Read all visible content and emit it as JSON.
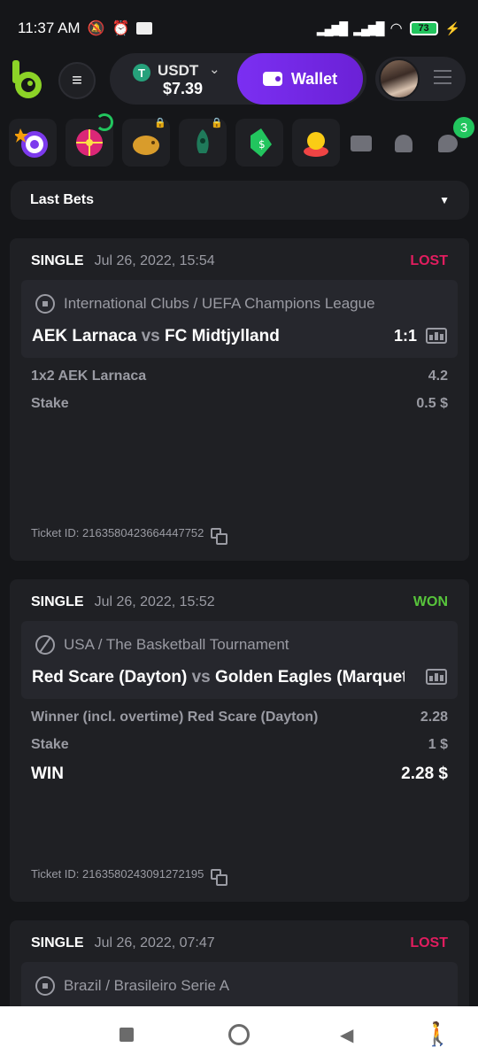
{
  "status_bar": {
    "time": "11:37 AM",
    "battery": "73"
  },
  "header": {
    "currency": "USDT",
    "balance": "$7.39",
    "wallet_label": "Wallet"
  },
  "notifications": {
    "chat_badge": "3"
  },
  "filter": {
    "label": "Last Bets"
  },
  "bets": [
    {
      "type": "SINGLE",
      "date": "Jul 26, 2022, 15:54",
      "result": "LOST",
      "league": "International Clubs / UEFA Champions League",
      "team1": "AEK Larnaca",
      "vs": "vs",
      "team2": "FC Midtjylland",
      "score": "1:1",
      "market": "1x2 AEK Larnaca",
      "odds": "4.2",
      "stake_label": "Stake",
      "stake": "0.5 $",
      "ticket": "Ticket ID: 2163580423664447752"
    },
    {
      "type": "SINGLE",
      "date": "Jul 26, 2022, 15:52",
      "result": "WON",
      "league": "USA / The Basketball Tournament",
      "team1": "Red Scare (Dayton)",
      "vs": "vs",
      "team2": "Golden Eagles (Marquette)",
      "score": "",
      "market": "Winner (incl. overtime) Red Scare (Dayton)",
      "odds": "2.28",
      "stake_label": "Stake",
      "stake": "1 $",
      "win_label": "WIN",
      "win": "2.28 $",
      "ticket": "Ticket ID: 2163580243091272195"
    },
    {
      "type": "SINGLE",
      "date": "Jul 26, 2022, 07:47",
      "result": "LOST",
      "league": "Brazil / Brasileiro Serie A"
    }
  ],
  "colors": {
    "lost": "#e11d5f",
    "won": "#57c43b",
    "accent": "#6b21d6",
    "badge": "#22c55e"
  }
}
